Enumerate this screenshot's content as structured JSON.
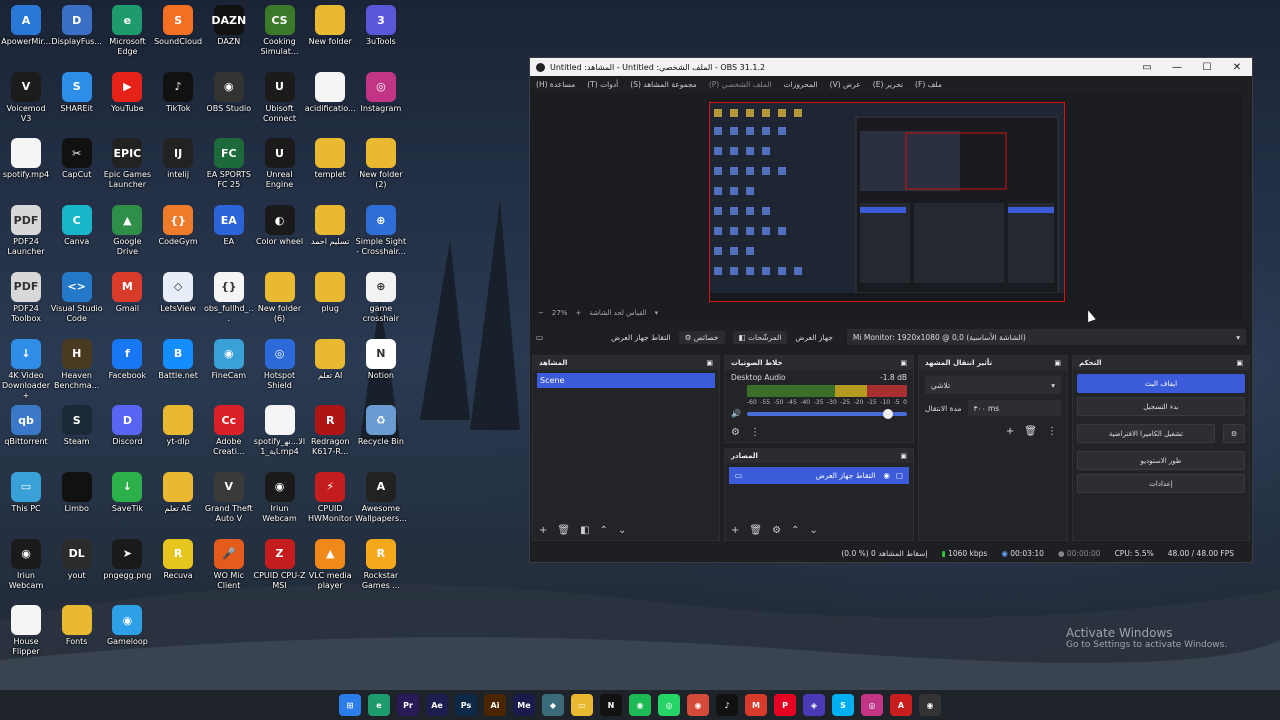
{
  "desktop_icons": [
    {
      "label": "ApowerMir...",
      "color": "#2a78d6",
      "glyph": "A"
    },
    {
      "label": "DisplayFus...",
      "color": "#3a6fc4",
      "glyph": "D"
    },
    {
      "label": "Microsoft Edge",
      "color": "#1e9b6d",
      "glyph": "e"
    },
    {
      "label": "SoundCloud",
      "color": "#f26f23",
      "glyph": "S"
    },
    {
      "label": "DAZN",
      "color": "#111111",
      "glyph": "DAZN"
    },
    {
      "label": "Cooking Simulat...",
      "color": "#3c7a2a",
      "glyph": "CS"
    },
    {
      "label": "New folder",
      "color": "#e8b931",
      "glyph": ""
    },
    {
      "label": "3uTools",
      "color": "#5b57d9",
      "glyph": "3"
    },
    {
      "label": "Voicemod V3",
      "color": "#1c1c1c",
      "glyph": "V"
    },
    {
      "label": "SHAREit",
      "color": "#2d8ee8",
      "glyph": "S"
    },
    {
      "label": "YouTube",
      "color": "#e62117",
      "glyph": "▶"
    },
    {
      "label": "TikTok",
      "color": "#111111",
      "glyph": "♪"
    },
    {
      "label": "OBS Studio",
      "color": "#333333",
      "glyph": "◉"
    },
    {
      "label": "Ubisoft Connect",
      "color": "#1b1b1b",
      "glyph": "U"
    },
    {
      "label": "acidificatio...",
      "color": "#f5f5f5",
      "glyph": ""
    },
    {
      "label": "Instagram",
      "color": "#c13584",
      "glyph": "◎"
    },
    {
      "label": "spotify.mp4",
      "color": "#f5f5f5",
      "glyph": ""
    },
    {
      "label": "CapCut",
      "color": "#111111",
      "glyph": "✂"
    },
    {
      "label": "Epic Games Launcher",
      "color": "#222222",
      "glyph": "EPIC"
    },
    {
      "label": "intelij",
      "color": "#222222",
      "glyph": "IJ"
    },
    {
      "label": "EA SPORTS FC 25",
      "color": "#1d6b3a",
      "glyph": "FC"
    },
    {
      "label": "Unreal Engine",
      "color": "#1a1a1a",
      "glyph": "U"
    },
    {
      "label": "templet",
      "color": "#e8b931",
      "glyph": ""
    },
    {
      "label": "New folder (2)",
      "color": "#e8b931",
      "glyph": ""
    },
    {
      "label": "PDF24 Launcher",
      "color": "#d8d8d8",
      "glyph": "PDF"
    },
    {
      "label": "Canva",
      "color": "#19b6c9",
      "glyph": "C"
    },
    {
      "label": "Google Drive",
      "color": "#2f8f48",
      "glyph": "▲"
    },
    {
      "label": "CodeGym",
      "color": "#ef7c2b",
      "glyph": "{}"
    },
    {
      "label": "EA",
      "color": "#2b63d9",
      "glyph": "EA"
    },
    {
      "label": "Color wheel",
      "color": "#1a1a1a",
      "glyph": "◐"
    },
    {
      "label": "تسليم احمد",
      "color": "#e8b931",
      "glyph": ""
    },
    {
      "label": "Simple Sight - Crosshair...",
      "color": "#2d6fd6",
      "glyph": "⊕"
    },
    {
      "label": "PDF24 Toolbox",
      "color": "#d8d8d8",
      "glyph": "PDF"
    },
    {
      "label": "Visual Studio Code",
      "color": "#2478c8",
      "glyph": "<>"
    },
    {
      "label": "Gmail",
      "color": "#d93b2b",
      "glyph": "M"
    },
    {
      "label": "LetsView",
      "color": "#e8eef8",
      "glyph": "◇"
    },
    {
      "label": "obs_fullhd_...",
      "color": "#f5f5f5",
      "glyph": "{}"
    },
    {
      "label": "New folder (6)",
      "color": "#e8b931",
      "glyph": ""
    },
    {
      "label": "plug",
      "color": "#e8b931",
      "glyph": ""
    },
    {
      "label": "game crosshair",
      "color": "#f2f2f2",
      "glyph": "⊕"
    },
    {
      "label": "4K Video Downloader+",
      "color": "#2f8de8",
      "glyph": "↓"
    },
    {
      "label": "Heaven Benchma...",
      "color": "#4a3a22",
      "glyph": "H"
    },
    {
      "label": "Facebook",
      "color": "#1877f2",
      "glyph": "f"
    },
    {
      "label": "Battle.net",
      "color": "#148eff",
      "glyph": "B"
    },
    {
      "label": "FineCam",
      "color": "#3aa0d8",
      "glyph": "◉"
    },
    {
      "label": "Hotspot Shield",
      "color": "#2b6ad8",
      "glyph": "◎"
    },
    {
      "label": "تعلم AI",
      "color": "#e8b931",
      "glyph": ""
    },
    {
      "label": "Notion",
      "color": "#ffffff",
      "glyph": "N"
    },
    {
      "label": "qBittorrent",
      "color": "#3b79c8",
      "glyph": "qb"
    },
    {
      "label": "Steam",
      "color": "#1b2838",
      "glyph": "S"
    },
    {
      "label": "Discord",
      "color": "#5865f2",
      "glyph": "D"
    },
    {
      "label": "yt-dlp",
      "color": "#e8b931",
      "glyph": ""
    },
    {
      "label": "Adobe Creati...",
      "color": "#da1f26",
      "glyph": "Cc"
    },
    {
      "label": "spotify_الا...نهاية_1.mp4",
      "color": "#f5f5f5",
      "glyph": ""
    },
    {
      "label": "Redragon K617-R...",
      "color": "#b01515",
      "glyph": "R"
    },
    {
      "label": "Recycle Bin",
      "color": "#6a9bd1",
      "glyph": "♻"
    },
    {
      "label": "This PC",
      "color": "#3aa0d8",
      "glyph": "▭"
    },
    {
      "label": "Limbo",
      "color": "#111111",
      "glyph": ""
    },
    {
      "label": "SaveTik",
      "color": "#2bb04a",
      "glyph": "↓"
    },
    {
      "label": "تعلم AE",
      "color": "#e8b931",
      "glyph": ""
    },
    {
      "label": "Grand Theft Auto V",
      "color": "#3a3a3a",
      "glyph": "V"
    },
    {
      "label": "Iriun Webcam",
      "color": "#1a1a1a",
      "glyph": "◉"
    },
    {
      "label": "CPUID HWMonitor",
      "color": "#c51d1d",
      "glyph": "⚡"
    },
    {
      "label": "Awesome Wallpapers...",
      "color": "#222222",
      "glyph": "A"
    },
    {
      "label": "Iriun Webcam",
      "color": "#1a1a1a",
      "glyph": "◉"
    },
    {
      "label": "yout",
      "color": "#2b2b2b",
      "glyph": "DL"
    },
    {
      "label": "pngegg.png",
      "color": "#1a1a1a",
      "glyph": "➤"
    },
    {
      "label": "Recuva",
      "color": "#e7c51f",
      "glyph": "R"
    },
    {
      "label": "WO Mic Client",
      "color": "#e45b1c",
      "glyph": "🎤"
    },
    {
      "label": "CPUID CPU-Z MSI",
      "color": "#c51d1d",
      "glyph": "Z"
    },
    {
      "label": "VLC media player",
      "color": "#ef8a1a",
      "glyph": "▲"
    },
    {
      "label": "Rockstar Games ...",
      "color": "#f3a91b",
      "glyph": "R"
    },
    {
      "label": "House Flipper",
      "color": "#f5f5f5",
      "glyph": ""
    },
    {
      "label": "Fonts",
      "color": "#e8b931",
      "glyph": ""
    },
    {
      "label": "Gameloop",
      "color": "#2da0e8",
      "glyph": "◉"
    }
  ],
  "watermark": {
    "line1": "Activate Windows",
    "line2": "Go to Settings to activate Windows."
  },
  "taskbar": [
    {
      "name": "start-icon",
      "color": "#2b7de9",
      "glyph": "⊞"
    },
    {
      "name": "edge-icon",
      "color": "#1e9b6d",
      "glyph": "e"
    },
    {
      "name": "premiere-icon",
      "color": "#2a1a55",
      "glyph": "Pr"
    },
    {
      "name": "aftereffects-icon",
      "color": "#1d1d4d",
      "glyph": "Ae"
    },
    {
      "name": "photoshop-icon",
      "color": "#0c2a48",
      "glyph": "Ps"
    },
    {
      "name": "illustrator-icon",
      "color": "#4a2500",
      "glyph": "Ai"
    },
    {
      "name": "mediaencoder-icon",
      "color": "#1a1a4d",
      "glyph": "Me"
    },
    {
      "name": "app-icon",
      "color": "#3a6b7a",
      "glyph": "◆"
    },
    {
      "name": "explorer-icon",
      "color": "#e8b931",
      "glyph": "▭"
    },
    {
      "name": "netflix-icon",
      "color": "#111111",
      "glyph": "N"
    },
    {
      "name": "spotify-icon",
      "color": "#1db954",
      "glyph": "◉"
    },
    {
      "name": "whatsapp-icon",
      "color": "#25d366",
      "glyph": "◎"
    },
    {
      "name": "chrome-icon",
      "color": "#d44b3a",
      "glyph": "◉"
    },
    {
      "name": "tiktok-icon",
      "color": "#111111",
      "glyph": "♪"
    },
    {
      "name": "gmail-icon",
      "color": "#d93b2b",
      "glyph": "M"
    },
    {
      "name": "pinterest-icon",
      "color": "#e60023",
      "glyph": "P"
    },
    {
      "name": "game-icon",
      "color": "#4b3ab5",
      "glyph": "◈"
    },
    {
      "name": "skype-icon",
      "color": "#00aff0",
      "glyph": "S"
    },
    {
      "name": "instagram-icon",
      "color": "#c13584",
      "glyph": "◎"
    },
    {
      "name": "acrobat-icon",
      "color": "#c81e1e",
      "glyph": "A"
    },
    {
      "name": "obs-icon",
      "color": "#333333",
      "glyph": "◉"
    }
  ],
  "obs": {
    "title": "OBS 31.1.2 - الملف الشخصي: Untitled - المشاهد: Untitled",
    "menus": [
      "ملف (F)",
      "تحرير (E)",
      "عرض (V)",
      "المحروزات",
      "الملف الشخصي (P)",
      "مجموعة المشاهد (S)",
      "أدوات (T)",
      "مساعدة (H)"
    ],
    "zoom": "27%",
    "preview_label": "القياس لحد الشاشة",
    "source_bar": {
      "source_name": "التقاط جهاز العرض",
      "properties": "خصائص",
      "filters": "المرشّحات",
      "device_label": "جهاز العرض",
      "device_value": "Mi Monitor: 1920x1080 @ 0,0 (الشاشة الأساسية)"
    },
    "scenes": {
      "title": "المشاهد",
      "items": [
        "Scene"
      ]
    },
    "mixer": {
      "title": "خلاط الصوتيات",
      "channel": "Desktop Audio",
      "level": "-1.8 dB",
      "ticks": [
        "-60",
        "-55",
        "-50",
        "-45",
        "-40",
        "-35",
        "-30",
        "-25",
        "-20",
        "-15",
        "-10",
        "-5",
        "0"
      ],
      "volume": 0.88
    },
    "transitions": {
      "title": "تأثير انتقال المشهد",
      "selected": "تلاشي",
      "duration_label": "مدة الانتقال",
      "duration_value": "٣٠٠ ms"
    },
    "sources": {
      "title": "المصادر",
      "items": [
        "التقاط جهاز العرض"
      ]
    },
    "controls": {
      "title": "التحكم",
      "buttons": [
        "ايقاف البث",
        "بدء التسجيل",
        "تشغيل الكاميرا الافتراضية",
        "طور الاستوديو",
        "إعدادات"
      ]
    },
    "status": {
      "dropped": "(0.0 %) 0 إسقاط المشاهد",
      "bitrate": "1060 kbps",
      "stream_time": "00:03:10",
      "rec_time": "00:00:00",
      "cpu": "CPU: 5.5%",
      "fps": "48.00 / 48.00 FPS"
    }
  }
}
